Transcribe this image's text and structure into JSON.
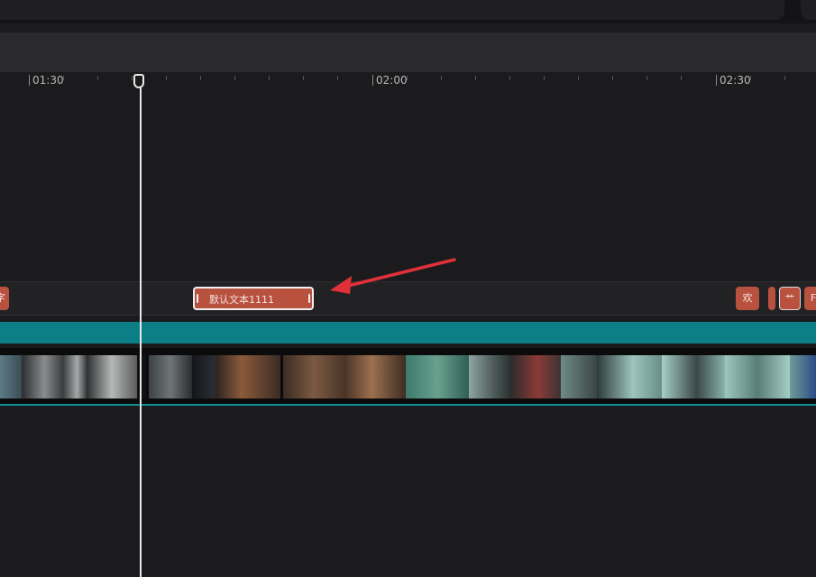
{
  "ruler": {
    "labels": [
      "01:30",
      "02:00",
      "02:30"
    ]
  },
  "text_track": {
    "selected_clip_label": "默认文本1111",
    "left_edge_clip_label": "字",
    "right_clip_labels": [
      "欢",
      "艹",
      "F"
    ]
  },
  "colors": {
    "background": "#1b1b1d",
    "text_clip": "#b9513f",
    "teal_track": "#0c7f86",
    "playhead": "#e8e8e8",
    "annotation_arrow": "#e0303a"
  },
  "icons": {
    "playhead_handle": "playhead-handle-icon",
    "annotation": "red-arrow-annotation"
  }
}
